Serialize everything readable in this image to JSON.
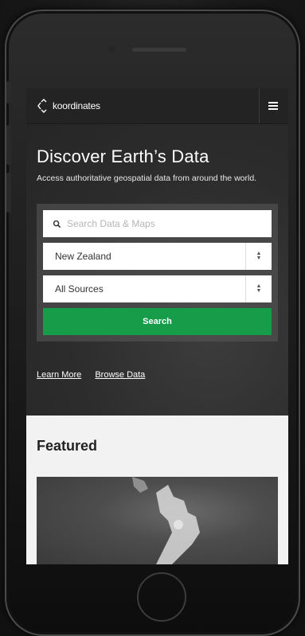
{
  "app": {
    "logo_text": "koordinates"
  },
  "hero": {
    "title": "Discover Earth’s Data",
    "subtitle": "Access authoritative geospatial data from around the world."
  },
  "search": {
    "placeholder": "Search Data & Maps",
    "region_select": {
      "value": "New Zealand"
    },
    "source_select": {
      "value": "All Sources"
    },
    "button_label": "Search"
  },
  "links": {
    "learn_more": "Learn More",
    "browse_data": "Browse Data"
  },
  "featured": {
    "title": "Featured"
  },
  "colors": {
    "accent_green": "#179c4a",
    "navbar_bg": "#232323",
    "featured_bg": "#f2f2f2"
  },
  "icons": {
    "menu": "hamburger-icon",
    "search": "search-icon",
    "select": "select-arrows-icon",
    "logo": "koordinates-logo-icon"
  }
}
